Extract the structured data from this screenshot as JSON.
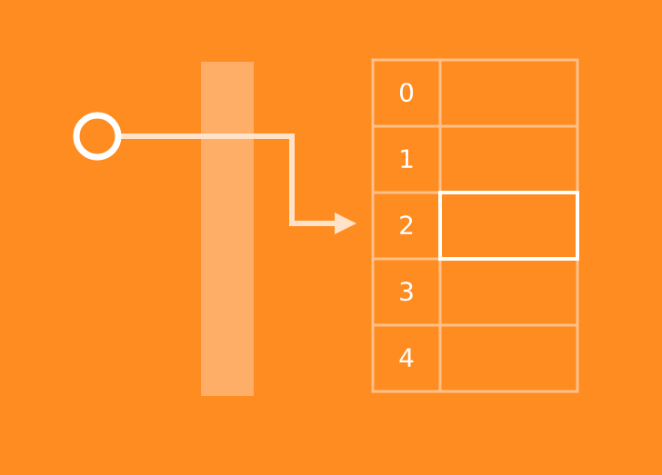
{
  "colors": {
    "background": "#ff8c21",
    "foreground": "#ffffff",
    "grid_line": "#ffc089",
    "barrier": "#ffae68",
    "connector": "#ffe2c7"
  },
  "table": {
    "rows": [
      {
        "index": "0"
      },
      {
        "index": "1"
      },
      {
        "index": "2"
      },
      {
        "index": "3"
      },
      {
        "index": "4"
      }
    ],
    "highlighted_row": 2
  },
  "icons": {
    "source": "circle-node-icon",
    "arrow": "arrow-right-icon"
  }
}
